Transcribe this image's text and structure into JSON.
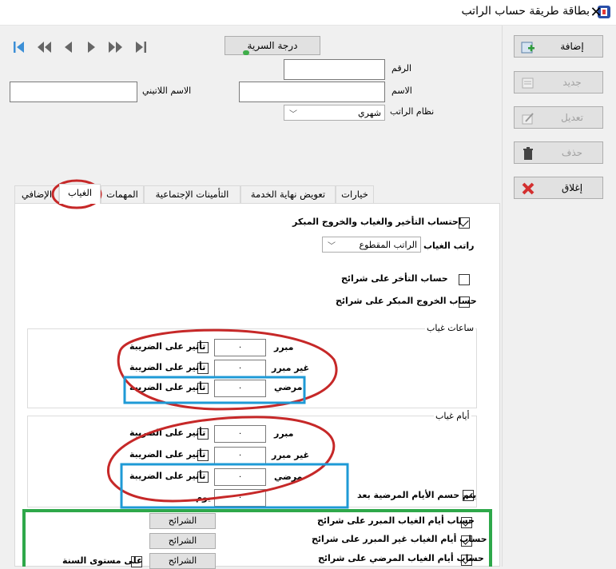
{
  "window": {
    "title": "بطاقة طريقة حساب الراتب",
    "close": "✕"
  },
  "nav": {
    "first": "first-record",
    "prev_fast": "previous-page",
    "prev": "previous",
    "next": "next",
    "next_fast": "next-page",
    "last": "last-record"
  },
  "header": {
    "degree_button": "درجة السرية",
    "number_label": "الرقم",
    "number_value": "",
    "name_label": "الاسم",
    "name_value": "",
    "latin_name_label": "الاسم اللاتيني",
    "latin_name_value": "",
    "salary_system_label": "نظام الراتب",
    "salary_system_value": "شهري"
  },
  "actions": {
    "add": "إضافة",
    "new": "جديد",
    "edit": "تعديل",
    "delete": "حذف",
    "close": "إغلاق"
  },
  "tabs": [
    "خيارات",
    "تعويض نهاية الخدمة",
    "التأمينات الإجتماعية",
    "المهمات",
    "الغياب",
    "الإضافي"
  ],
  "absence": {
    "calc_checkbox": "احتساب التأخير والغياب والخروج المبكر",
    "calc_checked": true,
    "salary_label": "راتب الغياب",
    "salary_value": "الراتب المقطوع",
    "late_tiers": "حساب التأخر على شرائح",
    "early_tiers": "حساب الخروج المبكر على شرائح",
    "hours_group": "ساعات غياب",
    "days_group": "أيام غياب",
    "justified": "مبرر",
    "unjustified": "غير مبرر",
    "sick": "مرضي",
    "tax_effect": "تأثير على الضريبة",
    "zero": "٠",
    "sick_deduct": "يتم حسم الأيام المرضية بعد",
    "day_label": "يوم",
    "tier_justified": "حساب أيام الغياب المبرر على شرائح",
    "tier_unjustified": "حساب أيام الغياب غير المبرر على شرائح",
    "tier_sick": "حساب أيام الغياب المرضي على شرائح",
    "tiers_button": "الشرائح",
    "year_level": "على مستوى السنة"
  },
  "colors": {
    "annotation_red": "#c62828",
    "annotation_blue": "#1e9ad6",
    "annotation_green": "#2ea84a"
  }
}
